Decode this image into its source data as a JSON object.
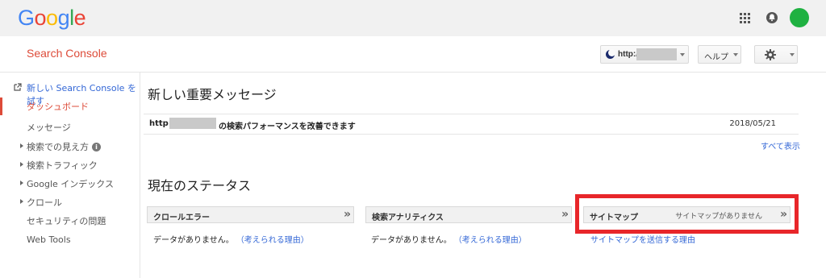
{
  "google_logo": [
    "G",
    "o",
    "o",
    "g",
    "l",
    "e"
  ],
  "google_logo_colors": [
    "#4285f4",
    "#ea4335",
    "#fbbc05",
    "#4285f4",
    "#34a853",
    "#ea4335"
  ],
  "header": {
    "title": "Search Console",
    "site_prefix": "http:/",
    "help_label": "ヘルプ"
  },
  "sidebar": {
    "items": [
      {
        "label": "新しい Search Console を試す"
      },
      {
        "label": "ダッシュボード"
      },
      {
        "label": "メッセージ"
      },
      {
        "label": "検索での見え方"
      },
      {
        "label": "検索トラフィック"
      },
      {
        "label": "Google インデックス"
      },
      {
        "label": "クロール"
      },
      {
        "label": "セキュリティの問題"
      },
      {
        "label": "Web Tools"
      }
    ],
    "info_glyph": "i"
  },
  "messages": {
    "heading": "新しい重要メッセージ",
    "row": {
      "prefix": "http:/",
      "text": "の検索パフォーマンスを改善できます",
      "date": "2018/05/21"
    },
    "show_all": "すべて表示"
  },
  "status": {
    "heading": "現在のステータス",
    "cards": [
      {
        "title": "クロールエラー",
        "body": "データがありません。",
        "link": "（考えられる理由）"
      },
      {
        "title": "検索アナリティクス",
        "body": "データがありません。",
        "link": "（考えられる理由）"
      },
      {
        "title": "サイトマップ",
        "sub": "サイトマップがありません",
        "link": "サイトマップを送信する理由"
      }
    ],
    "chevron": "»"
  },
  "colors": {
    "brand_red": "#dd4b39",
    "link_blue": "#3367d6",
    "highlight_red": "#e8262a",
    "avatar_green": "#1fb141"
  }
}
